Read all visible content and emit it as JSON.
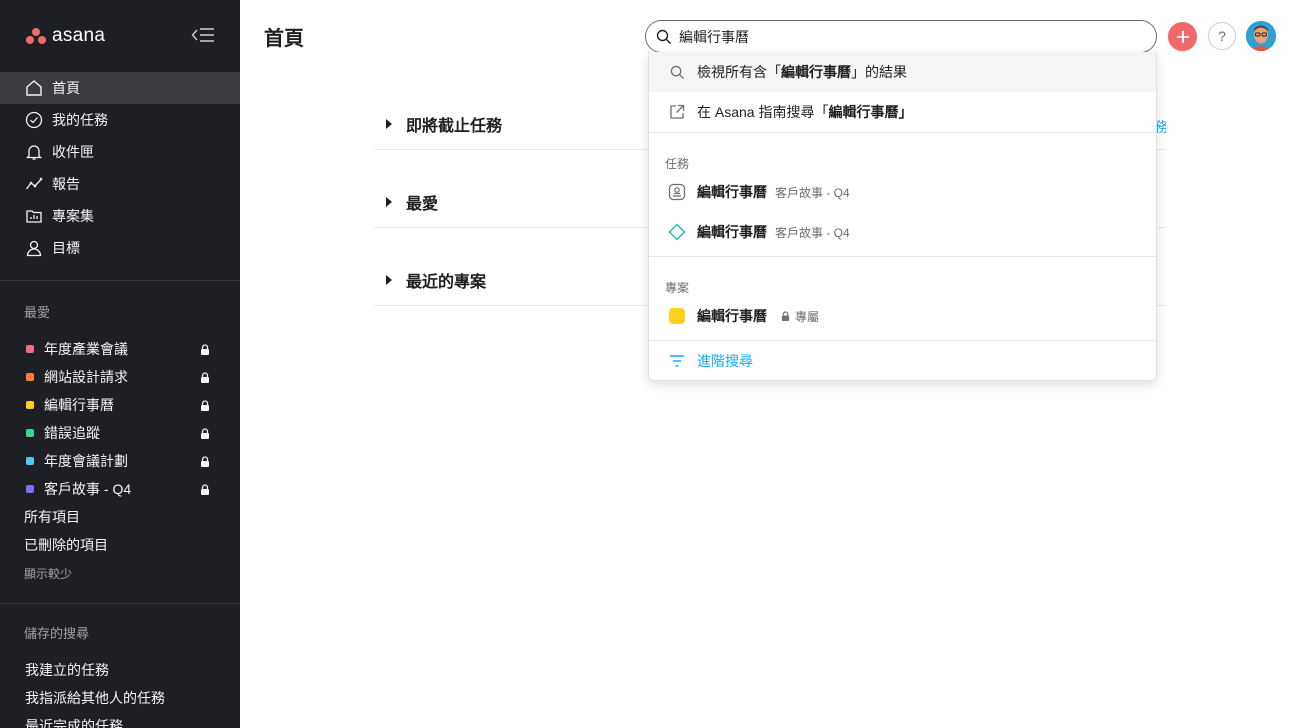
{
  "app": {
    "name": "asana",
    "page_title": "首頁"
  },
  "sidebar": {
    "nav": [
      {
        "label": "首頁",
        "icon": "home-icon",
        "active": true
      },
      {
        "label": "我的任務",
        "icon": "check-circle-icon",
        "active": false
      },
      {
        "label": "收件匣",
        "icon": "bell-icon",
        "active": false
      },
      {
        "label": "報告",
        "icon": "trend-line-icon",
        "active": false
      },
      {
        "label": "專案集",
        "icon": "portfolio-icon",
        "active": false
      },
      {
        "label": "目標",
        "icon": "person-icon",
        "active": false
      }
    ],
    "favorites_title": "最愛",
    "favorites": [
      {
        "label": "年度產業會議",
        "color": "#f06a8a"
      },
      {
        "label": "網站設計請求",
        "color": "#fd7e3c"
      },
      {
        "label": "編輯行事曆",
        "color": "#fcd01c"
      },
      {
        "label": "錯誤追蹤",
        "color": "#3dd68c"
      },
      {
        "label": "年度會議計劃",
        "color": "#4ecbf5"
      },
      {
        "label": "客戶故事 - Q4",
        "color": "#7a6ff0"
      }
    ],
    "all_items": "所有項目",
    "deleted_items": "已刪除的項目",
    "show_less": "顯示較少",
    "saved_title": "儲存的搜尋",
    "saved": [
      "我建立的任務",
      "我指派給其他人的任務",
      "最近完成的任務"
    ]
  },
  "main": {
    "sections": [
      "即將截止任務",
      "最愛",
      "最近的專案"
    ],
    "peek_link": "務"
  },
  "search": {
    "value": "編輯行事曆",
    "view_all_prefix": "檢視所有含「",
    "view_all_term": "編輯行事曆",
    "view_all_suffix": "」的結果",
    "guide_prefix": "在 Asana 指南搜尋「",
    "guide_term": "編輯行事曆",
    "guide_suffix": "」",
    "tasks_header": "任務",
    "task_results": [
      {
        "title": "編輯行事曆",
        "project": "客戶故事 - Q4",
        "icon": "approval-icon"
      },
      {
        "title": "編輯行事曆",
        "project": "客戶故事 - Q4",
        "icon": "milestone-diamond-icon"
      }
    ],
    "projects_header": "專案",
    "project_result": {
      "title": "編輯行事曆",
      "privacy": "專屬",
      "color": "#fcd01c"
    },
    "advanced": "進階搜尋"
  },
  "topbar": {
    "help": "?"
  },
  "colors": {
    "accent_blue": "#14aaf5",
    "plus_coral": "#f06a6a",
    "sidebar_bg": "#1e1f25"
  }
}
